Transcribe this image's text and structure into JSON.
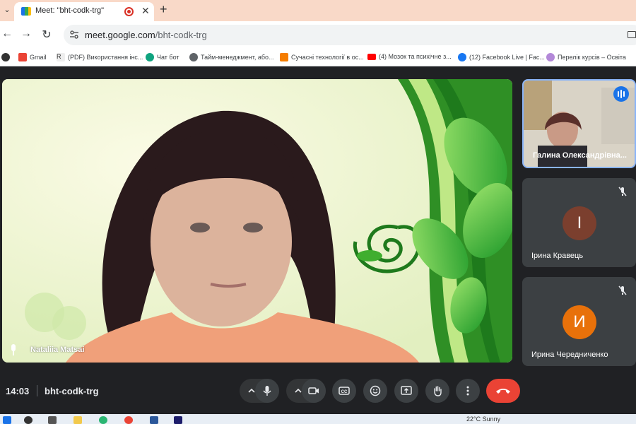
{
  "browser": {
    "tab_title": "Meet: \"bht-codk-trg\"",
    "url_host": "meet.google.com",
    "url_path": "/bht-codk-trg",
    "bookmarks": [
      {
        "label": "Gmail",
        "icon": "gmail-icon",
        "color": "#ea4335"
      },
      {
        "label": "(PDF) Використання інс...",
        "icon": "researchgate-icon",
        "color": "#00ccbb"
      },
      {
        "label": "Чат бот",
        "icon": "chatgpt-icon",
        "color": "#10a37f"
      },
      {
        "label": "Тайм-менеджмент, або...",
        "icon": "globe-icon",
        "color": "#5f6368"
      },
      {
        "label": "Сучасні технології в ос...",
        "icon": "blogger-icon",
        "color": "#f57d00"
      },
      {
        "label": "(4) Мозок та психічне з...",
        "icon": "youtube-icon",
        "color": "#ff0000"
      },
      {
        "label": "(12) Facebook Live | Fac...",
        "icon": "facebook-icon",
        "color": "#1877f2"
      },
      {
        "label": "Перелік курсів – Освіта",
        "icon": "course-icon",
        "color": "#9c27b0"
      }
    ]
  },
  "main_tile": {
    "name": "Nataliia Matsai"
  },
  "participants": [
    {
      "name": "Галина Олександрівна...",
      "type": "video",
      "speaking": true
    },
    {
      "name": "Ірина Кравець",
      "initial": "І",
      "avatar_color": "#7b3f2e",
      "muted": true
    },
    {
      "name": "Ирина Чередниченко",
      "initial": "И",
      "avatar_color": "#e8710a",
      "muted": true
    }
  ],
  "controls": {
    "time": "14:03",
    "meeting_code": "bht-codk-trg"
  },
  "taskbar": {
    "weather": "22°C  Sunny"
  }
}
